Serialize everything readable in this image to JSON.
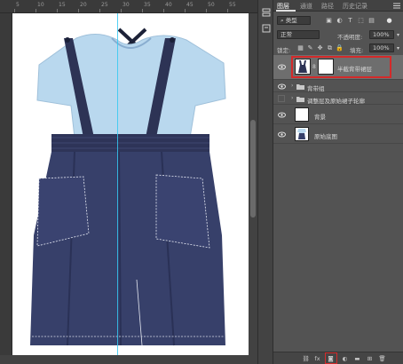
{
  "ruler": {
    "ticks": [
      "5",
      "10",
      "15",
      "20",
      "25",
      "30",
      "35",
      "40",
      "45",
      "50",
      "55"
    ]
  },
  "tabs": [
    {
      "label": "图层",
      "active": true
    },
    {
      "label": "通道",
      "active": false
    },
    {
      "label": "路径",
      "active": false
    },
    {
      "label": "历史记录",
      "active": false
    }
  ],
  "filter": {
    "kind_label": "类型"
  },
  "blend": {
    "mode": "正常",
    "opacity_label": "不透明度:",
    "opacity_value": "100%"
  },
  "lock": {
    "label": "锁定:",
    "fill_label": "填充:",
    "fill_value": "100%"
  },
  "layers": [
    {
      "name": "半截背带裙层",
      "type": "layer-with-mask",
      "visible": true,
      "selected": true
    },
    {
      "name": "背带组",
      "type": "group",
      "visible": true,
      "selected": false
    },
    {
      "name": "调整层及原始裙子轮廓",
      "type": "group",
      "visible": false,
      "selected": false
    },
    {
      "name": "背景",
      "type": "layer",
      "visible": true,
      "selected": false
    },
    {
      "name": "原始底图",
      "type": "layer",
      "visible": true,
      "selected": false
    }
  ],
  "bottom_bar": {
    "fx_label": "fx"
  },
  "colors": {
    "guide": "#35c9f2",
    "highlight": "#d42a2a",
    "panel_bg": "#535353",
    "selected_row": "#6e6e6e"
  }
}
